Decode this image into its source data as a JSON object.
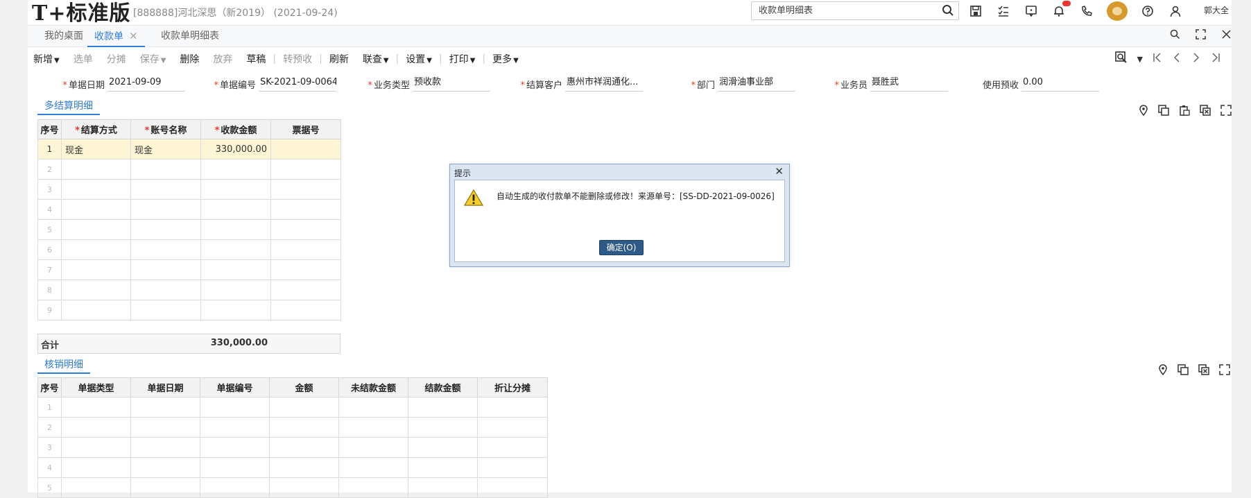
{
  "header": {
    "logo": "T+标准版",
    "company": "[888888]河北深思（新2019）  (2021-09-24)",
    "search_value": "收款单明细表",
    "username": "郭大全",
    "icons": [
      "save-icon",
      "todo-list-icon",
      "message-icon",
      "bell-icon",
      "phone-icon",
      "avatar",
      "help-icon",
      "user-icon"
    ]
  },
  "tabs": [
    {
      "label": "我的桌面"
    },
    {
      "label": "收款单"
    },
    {
      "label": "收款单明细表"
    }
  ],
  "toolbar": {
    "new": "新增",
    "select": "选单",
    "split": "分摊",
    "save": "保存",
    "delete": "删除",
    "abandon": "放弃",
    "draft": "草稿",
    "convert": "转预收",
    "refresh": "刷新",
    "link": "联查",
    "settings": "设置",
    "print": "打印",
    "more": "更多"
  },
  "form": {
    "date_label": "单据日期",
    "date": "2021-09-09",
    "code_label": "单据编号",
    "code": "SK-2021-09-0064",
    "biztype_label": "业务类型",
    "biztype": "预收款",
    "customer_label": "结算客户",
    "customer": "惠州市祥润通化...",
    "dept_label": "部门",
    "dept": "润滑油事业部",
    "clerk_label": "业务员",
    "clerk": "聂胜武",
    "prepay_label": "使用预收",
    "prepay": "0.00"
  },
  "settlement": {
    "title": "多结算明细",
    "headers": [
      "序号",
      "结算方式",
      "账号名称",
      "收款金额",
      "票据号"
    ],
    "rows": [
      {
        "idx": "1",
        "method": "现金",
        "account": "现金",
        "amount": "330,000.00",
        "bill": ""
      },
      {
        "idx": "2"
      },
      {
        "idx": "3"
      },
      {
        "idx": "4"
      },
      {
        "idx": "5"
      },
      {
        "idx": "6"
      },
      {
        "idx": "7"
      },
      {
        "idx": "8"
      },
      {
        "idx": "9"
      }
    ],
    "total_label": "合计",
    "total_amount": "330,000.00"
  },
  "writeoff": {
    "title": "核销明细",
    "headers": [
      "序号",
      "单据类型",
      "单据日期",
      "单据编号",
      "金额",
      "未结款金额",
      "结款金额",
      "折让分摊"
    ],
    "rows": [
      {
        "idx": "1"
      },
      {
        "idx": "2"
      },
      {
        "idx": "3"
      },
      {
        "idx": "4"
      },
      {
        "idx": "5"
      }
    ]
  },
  "dialog": {
    "title": "提示",
    "message": "自动生成的收付款单不能删除或修改！来源单号：[SS-DD-2021-09-0026]",
    "ok": "确定(O)"
  },
  "colors": {
    "accent": "#2f7cd8",
    "selected_row": "#fdf5d4",
    "dialog_button": "#2e5a87",
    "required": "#e33333"
  }
}
